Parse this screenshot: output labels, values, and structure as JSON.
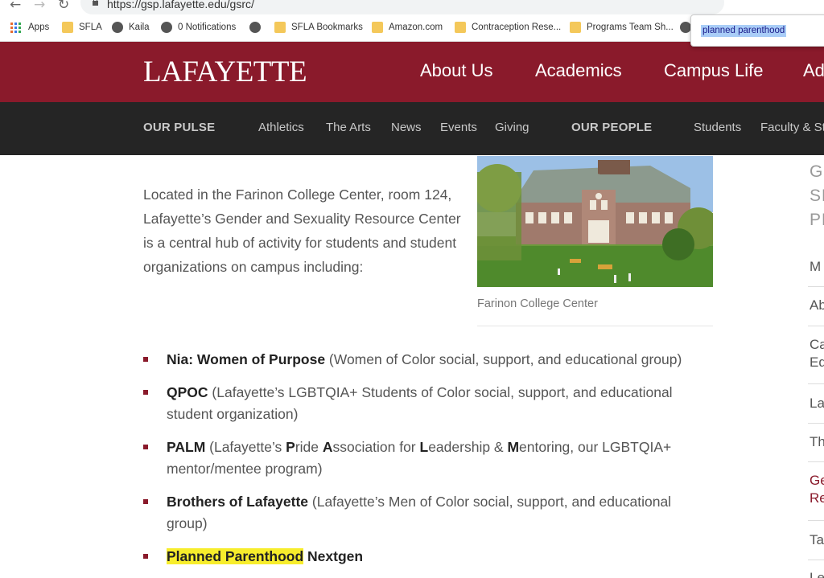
{
  "browser": {
    "url": "https://gsp.lafayette.edu/gsrc/",
    "find_query": "planned parenthood",
    "bookmarks": [
      {
        "icon": "apps-icon",
        "label": "Apps"
      },
      {
        "icon": "folder-icon",
        "label": "SFLA"
      },
      {
        "icon": "globe-icon",
        "label": "Kaila"
      },
      {
        "icon": "globe-icon",
        "label": "0 Notifications"
      },
      {
        "icon": "globe-icon",
        "label": ""
      },
      {
        "icon": "folder-icon",
        "label": "SFLA Bookmarks"
      },
      {
        "icon": "folder-icon",
        "label": "Amazon.com"
      },
      {
        "icon": "folder-icon",
        "label": "Contraception Rese..."
      },
      {
        "icon": "folder-icon",
        "label": "Programs Team Sh..."
      },
      {
        "icon": "globe-icon",
        "label": ""
      }
    ]
  },
  "site": {
    "logo": "LAFAYETTE",
    "brand_color": "#8a1a2b",
    "main_nav": [
      "About Us",
      "Academics",
      "Campus Life",
      "Ad"
    ],
    "sub_nav": {
      "pulse_heading": "OUR PULSE",
      "pulse_items": [
        "Athletics",
        "The Arts",
        "News",
        "Events",
        "Giving"
      ],
      "people_heading": "OUR PEOPLE",
      "people_items": [
        "Students",
        "Faculty & St"
      ]
    }
  },
  "content": {
    "intro": "Located in the Farinon College Center, room 124, Lafayette’s Gender and Sexuality Resource Center is a central hub of activity for students and student organizations on campus including:",
    "photo_caption": "Farinon College Center",
    "orgs": [
      {
        "name": "Nia: Women of Purpose",
        "desc": " (Women of Color social, support, and educational group)"
      },
      {
        "name": "QPOC",
        "desc": " (Lafayette’s LGBTQIA+ Students of Color social, support, and educational student organization)"
      },
      {
        "name": "PALM",
        "desc_parts": [
          " (Lafayette’s ",
          "P",
          "ride ",
          "A",
          "ssociation for ",
          "L",
          "eadership & ",
          "M",
          "entoring, our LGBTQIA+ mentor/mentee program)"
        ]
      },
      {
        "name": "Brothers of Lafayette",
        "desc": " (Lafayette’s Men of Color social, support, and educational group)"
      },
      {
        "name_highlight": "Planned Parenthood",
        "name_rest": " Nextgen"
      }
    ]
  },
  "sidebar": {
    "heading": [
      "G",
      "SE",
      "PF"
    ],
    "items": [
      "M",
      "Ab",
      "Ca\nEd",
      "La",
      "Th",
      "Ge\nRe",
      "Ta",
      "Le"
    ],
    "active_index": 5
  }
}
